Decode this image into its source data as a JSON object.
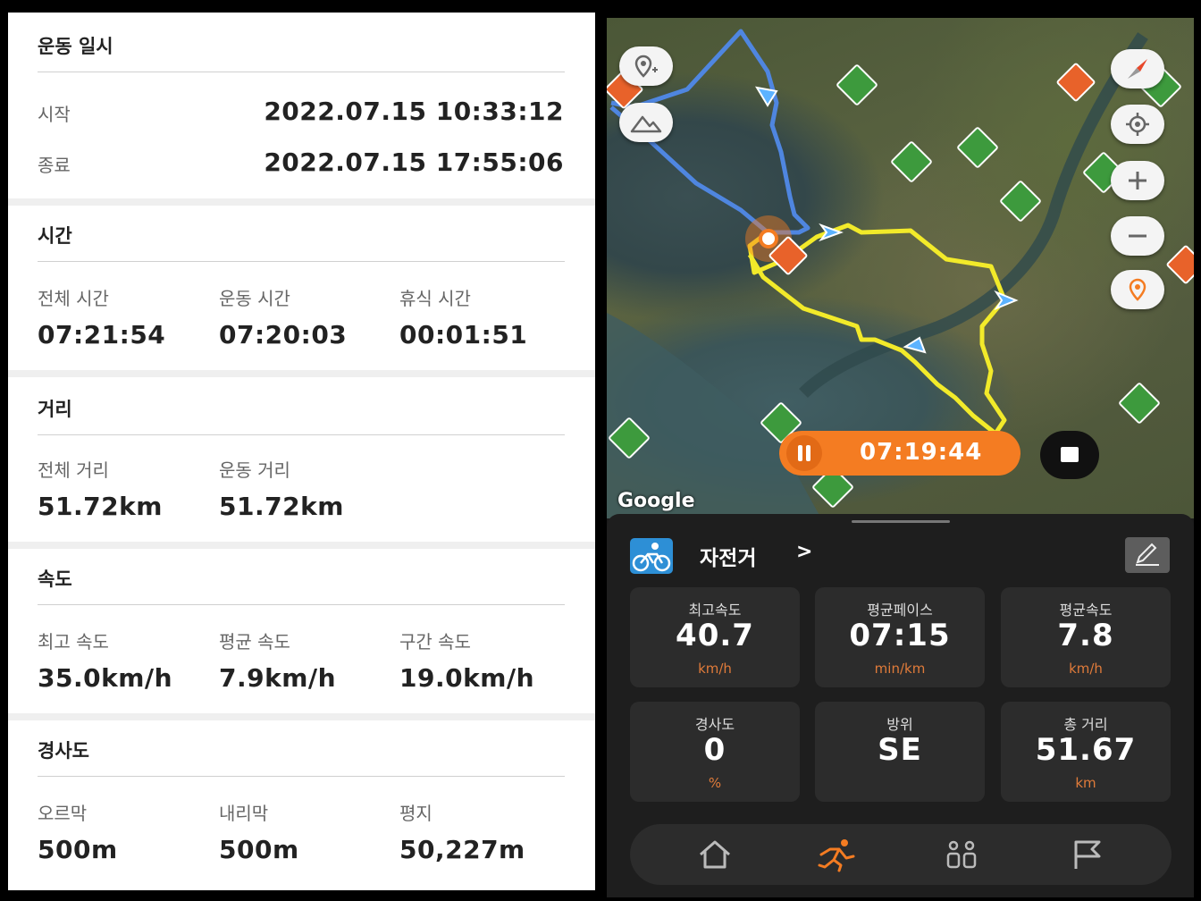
{
  "summary": {
    "datetime": {
      "title": "운동 일시",
      "start_label": "시작",
      "start_value": "2022.07.15 10:33:12",
      "end_label": "종료",
      "end_value": "2022.07.15 17:55:06"
    },
    "time": {
      "title": "시간",
      "items": [
        {
          "label": "전체 시간",
          "value": "07:21:54"
        },
        {
          "label": "운동 시간",
          "value": "07:20:03"
        },
        {
          "label": "휴식 시간",
          "value": "00:01:51"
        }
      ]
    },
    "distance": {
      "title": "거리",
      "items": [
        {
          "label": "전체 거리",
          "value": "51.72km"
        },
        {
          "label": "운동 거리",
          "value": "51.72km"
        }
      ]
    },
    "speed": {
      "title": "속도",
      "items": [
        {
          "label": "최고 속도",
          "value": "35.0km/h"
        },
        {
          "label": "평균 속도",
          "value": "7.9km/h"
        },
        {
          "label": "구간 속도",
          "value": "19.0km/h"
        }
      ]
    },
    "slope": {
      "title": "경사도",
      "items": [
        {
          "label": "오르막",
          "value": "500m"
        },
        {
          "label": "내리막",
          "value": "500m"
        },
        {
          "label": "평지",
          "value": "50,227m"
        }
      ]
    }
  },
  "map": {
    "attribution": "Google",
    "timer": "07:19:44",
    "route_color": "#f2ea2a",
    "prior_route_color": "#4f86e0",
    "accent": "#f47c22"
  },
  "activity": {
    "sport": "자전거",
    "chevron": ">",
    "stats": [
      {
        "title": "최고속도",
        "value": "40.7",
        "unit": "km/h"
      },
      {
        "title": "평균페이스",
        "value": "07:15",
        "unit": "min/km"
      },
      {
        "title": "평균속도",
        "value": "7.8",
        "unit": "km/h"
      },
      {
        "title": "경사도",
        "value": "0",
        "unit": "%"
      },
      {
        "title": "방위",
        "value": "SE",
        "unit": ""
      },
      {
        "title": "총 거리",
        "value": "51.67",
        "unit": "km"
      }
    ],
    "nav": [
      "home-icon",
      "running-icon",
      "people-icon",
      "flag-icon"
    ]
  }
}
